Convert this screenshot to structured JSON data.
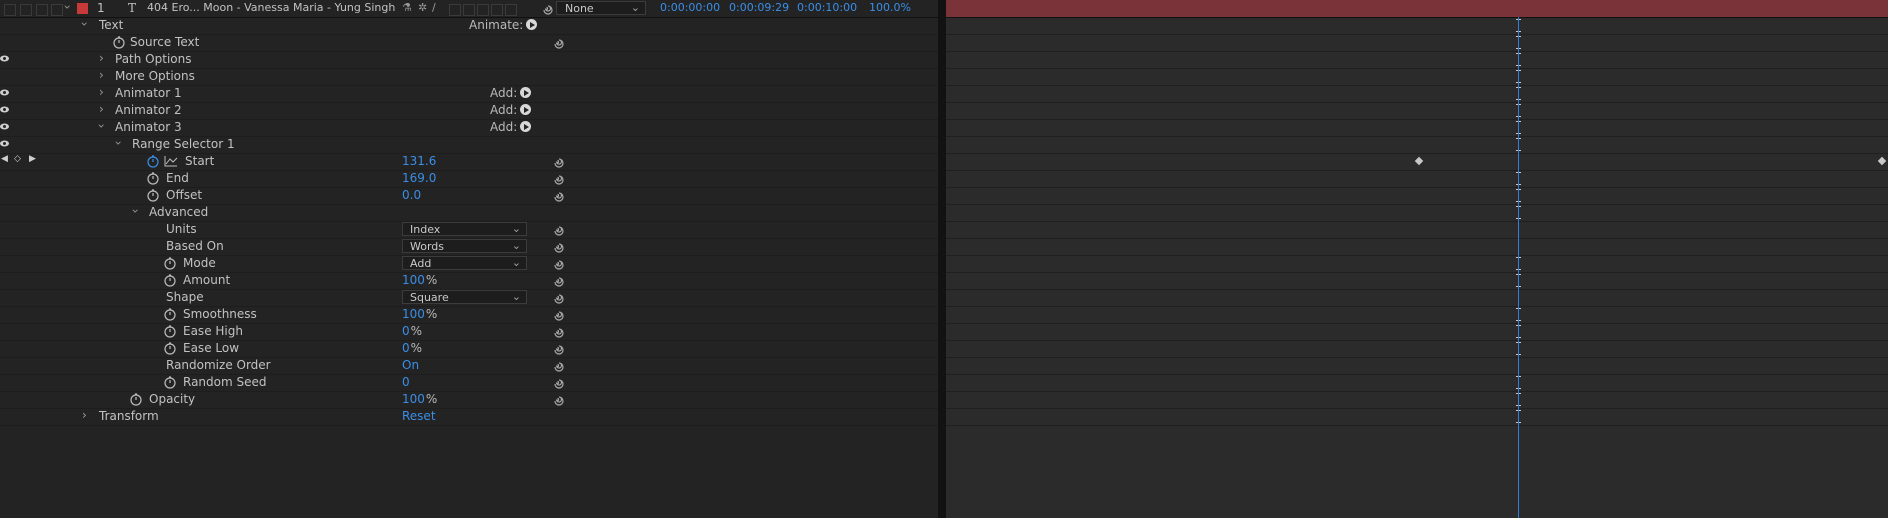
{
  "layer": {
    "number": "1",
    "type_icon": "T",
    "name": "404 Ero... Moon - Vanessa Maria - Yung Singh",
    "label_color": "#c8393a",
    "parent": "None",
    "in_time": "0:00:00:00",
    "out_time": "0:00:09:29",
    "duration": "0:00:10:00",
    "stretch": "100.0%"
  },
  "props": {
    "text": "Text",
    "animate_label": "Animate:",
    "source_text": "Source Text",
    "path_options": "Path Options",
    "more_options": "More Options",
    "animator1": "Animator 1",
    "animator2": "Animator 2",
    "animator3": "Animator 3",
    "add_label": "Add:",
    "range_selector": "Range Selector 1",
    "start": "Start",
    "start_val": "131.6",
    "end": "End",
    "end_val": "169.0",
    "offset": "Offset",
    "offset_val": "0.0",
    "advanced": "Advanced",
    "units": "Units",
    "units_val": "Index",
    "based_on": "Based On",
    "based_on_val": "Words",
    "mode": "Mode",
    "mode_val": "Add",
    "amount": "Amount",
    "amount_val": "100",
    "shape": "Shape",
    "shape_val": "Square",
    "smoothness": "Smoothness",
    "smoothness_val": "100",
    "ease_high": "Ease High",
    "ease_high_val": "0",
    "ease_low": "Ease Low",
    "ease_low_val": "0",
    "randomize_order": "Randomize Order",
    "randomize_order_val": "On",
    "random_seed": "Random Seed",
    "random_seed_val": "0",
    "opacity": "Opacity",
    "opacity_val": "100",
    "transform": "Transform",
    "transform_val": "Reset",
    "percent": "%"
  },
  "colors": {
    "value_blue": "#3a8ee6",
    "layer_bar": "#7a3338",
    "playhead": "#2f7fd6"
  }
}
